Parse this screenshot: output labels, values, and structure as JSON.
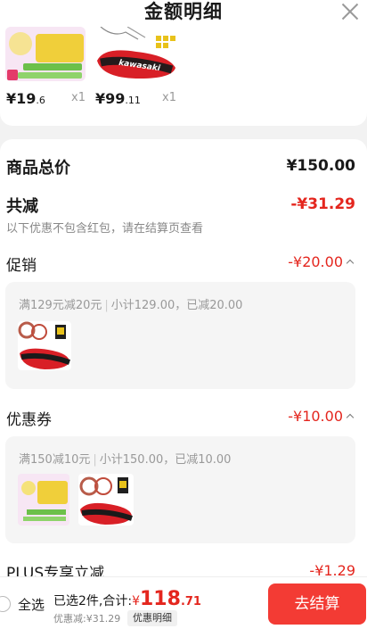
{
  "header": {
    "title": "金额明细"
  },
  "products": [
    {
      "price_main": "¥19",
      "price_dec": ".6",
      "qty": "x1",
      "image": "yellow-product-package"
    },
    {
      "price_main": "¥99",
      "price_dec": ".11",
      "qty": "x1",
      "image": "kawasaki-racket-bag",
      "brand": "kawasaki"
    }
  ],
  "summary": {
    "total_label": "商品总价",
    "total_value": "¥150.00",
    "reduce_label": "共减",
    "reduce_value": "-¥31.29",
    "reduce_note": "以下优惠不包含红包，请在结算页查看"
  },
  "promotion": {
    "label": "促销",
    "value": "-¥20.00",
    "rule": "满129元减20元",
    "subtotal": "小计129.00，已减20.00"
  },
  "coupon": {
    "label": "优惠券",
    "value": "-¥10.00",
    "rule": "满150减10元",
    "subtotal": "小计150.00，已减10.00"
  },
  "plus": {
    "label": "PLUS专享立减",
    "value": "-¥1.29"
  },
  "footer": {
    "select_all": "全选",
    "selected": "已选2件,合计:",
    "currency": "¥",
    "total_main": "118",
    "total_dec": ".71",
    "discount": "优惠减:¥31.29",
    "detail_label": "优惠明细",
    "checkout_label": "去结算"
  },
  "colors": {
    "accent": "#e4261e",
    "checkout": "#f33b34"
  }
}
